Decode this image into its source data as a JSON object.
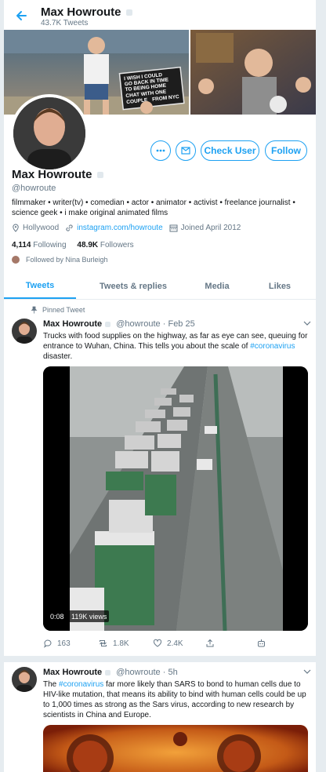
{
  "header": {
    "name": "Max Howroute",
    "tweet_count": "43.7K Tweets"
  },
  "profile": {
    "name": "Max Howroute",
    "handle": "@howroute",
    "bio": "filmmaker • writer(tv) • comedian • actor • animator • activist • freelance journalist • science geek • i make original animated films",
    "location": "Hollywood",
    "website": "instagram.com/howroute",
    "joined": "Joined April 2012",
    "following_count": "4,114",
    "following_label": "Following",
    "followers_count": "48.9K",
    "followers_label": "Followers",
    "followed_by": "Followed by Nina Burleigh",
    "check_user_label": "Check User",
    "follow_label": "Follow",
    "banner_sign": [
      "I WISH I COULD",
      "GO BACK IN TIME",
      "TO BEING HOME",
      "CHAT WITH ONE",
      "COUPLE",
      "FROM NYC"
    ]
  },
  "tabs": [
    "Tweets",
    "Tweets & replies",
    "Media",
    "Likes"
  ],
  "tweets": [
    {
      "pinned_label": "Pinned Tweet",
      "name": "Max Howroute",
      "handle": "@howroute",
      "sep": "·",
      "date": "Feb 25",
      "text_before": "Trucks with food supplies on the highway, as far as eye can see, queuing for entrance to Wuhan, China. This tells you about the scale of ",
      "hashtag": "#coronavirus",
      "text_after": " disaster.",
      "video_time": "0:08",
      "video_views": "119K views",
      "replies": "163",
      "retweets": "1.8K",
      "likes": "2.4K"
    },
    {
      "name": "Max Howroute",
      "handle": "@howroute",
      "sep": "·",
      "date": "5h",
      "text_before": "The ",
      "hashtag": "#coronavirus",
      "text_after": " far more likely than SARS to bond to human cells due to HIV-like mutation, that means its ability to bind with human cells could be up to 1,000 times as strong as the Sars virus, according to new research by scientists in China and Europe."
    }
  ],
  "colors": {
    "accent": "#1da1f2",
    "muted": "#657786",
    "divider": "#e6ecf0"
  }
}
